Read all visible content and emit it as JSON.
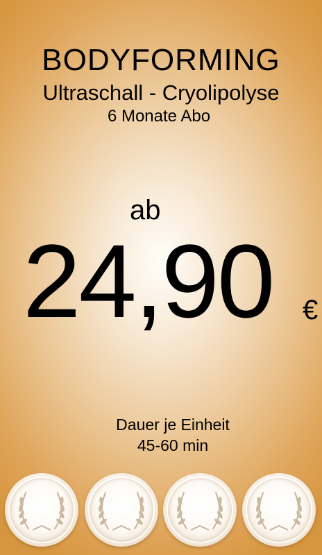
{
  "header": {
    "title": "BODYFORMING",
    "subtitle": "Ultraschall - Cryolipolyse",
    "plan": "6 Monate Abo"
  },
  "price": {
    "prefix": "ab",
    "amount": "24,90",
    "currency": "€"
  },
  "duration": {
    "label": "Dauer je Einheit",
    "value": "45-60 min"
  },
  "medals": [
    {
      "icon": "laurel-wreath-icon"
    },
    {
      "icon": "laurel-wreath-icon"
    },
    {
      "icon": "laurel-wreath-icon"
    },
    {
      "icon": "laurel-wreath-icon"
    }
  ],
  "colors": {
    "background_center": "#fffdf9",
    "background_edge": "#d6963f",
    "text": "#000000"
  }
}
